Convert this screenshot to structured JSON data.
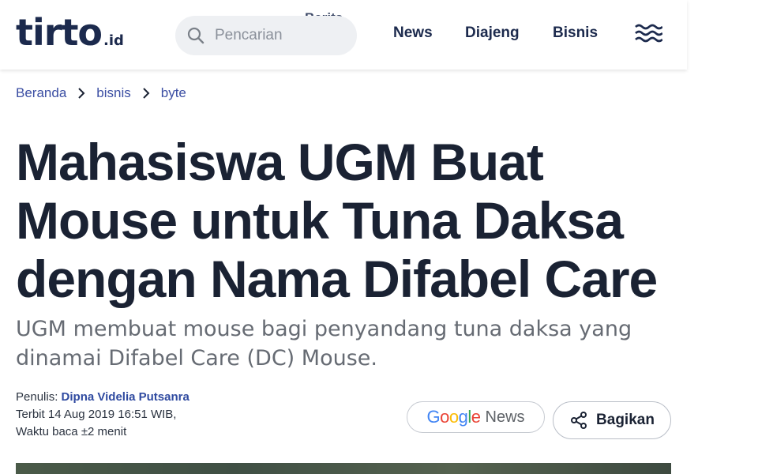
{
  "header": {
    "logo_main": "tirto",
    "logo_suffix": ".id",
    "search_placeholder": "Pencarian",
    "ghost_text": "Berita",
    "nav": [
      {
        "label": "News"
      },
      {
        "label": "Diajeng"
      },
      {
        "label": "Bisnis"
      }
    ],
    "menu_icon": "hamburger-waves-icon"
  },
  "breadcrumb": {
    "items": [
      "Beranda",
      "bisnis",
      "byte"
    ]
  },
  "article": {
    "title": "Mahasiswa UGM Buat Mouse untuk Tuna Daksa dengan Nama Difabel Care",
    "subtitle": "UGM membuat mouse bagi penyandang tuna daksa yang dinamai Difabel Care (DC) Mouse.",
    "author_label": "Penulis: ",
    "author_name": "Dipna Videlia Putsanra",
    "published": "Terbit 14 Aug 2019 16:51 WIB,",
    "read_time": "Waktu baca ±2 menit"
  },
  "actions": {
    "google_news_brand": "Google",
    "google_news_label": "News",
    "share_label": "Bagikan"
  },
  "colors": {
    "brand_navy": "#1c2a4d",
    "link_blue": "#3b4ea3"
  }
}
